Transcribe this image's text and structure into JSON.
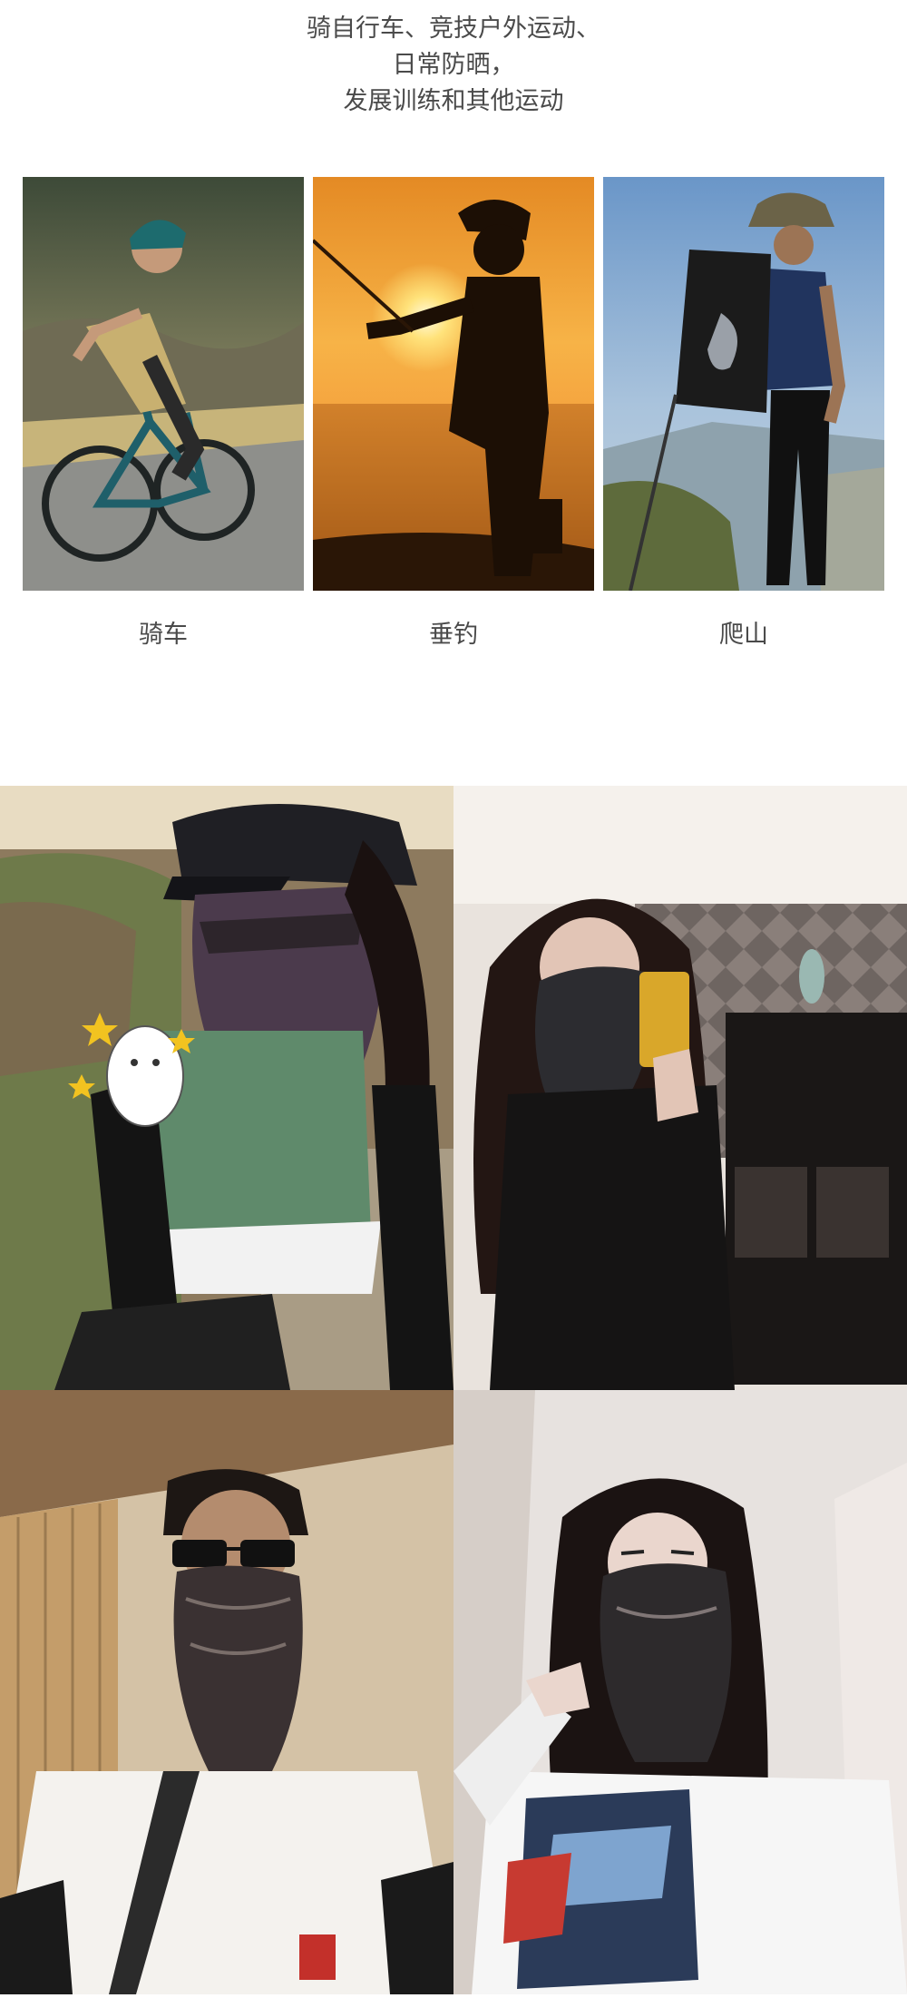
{
  "headline": {
    "line1": "骑自行车、竞技户外运动、",
    "line2": "日常防晒，",
    "line3": "发展训练和其他运动"
  },
  "activities": [
    {
      "caption": "骑车",
      "icon": "cycling-photo"
    },
    {
      "caption": "垂钓",
      "icon": "fishing-photo"
    },
    {
      "caption": "爬山",
      "icon": "hiking-photo"
    }
  ],
  "lifestyle_photos": [
    {
      "icon": "cyclist-selfie-photo"
    },
    {
      "icon": "mirror-selfie-photo"
    },
    {
      "icon": "man-selfie-photo"
    },
    {
      "icon": "woman-selfie-photo"
    }
  ],
  "colors": {
    "text": "#4a4a4a",
    "background": "#ffffff",
    "sunset_orange": "#f08a1a",
    "sky_blue": "#7fa9d6"
  }
}
